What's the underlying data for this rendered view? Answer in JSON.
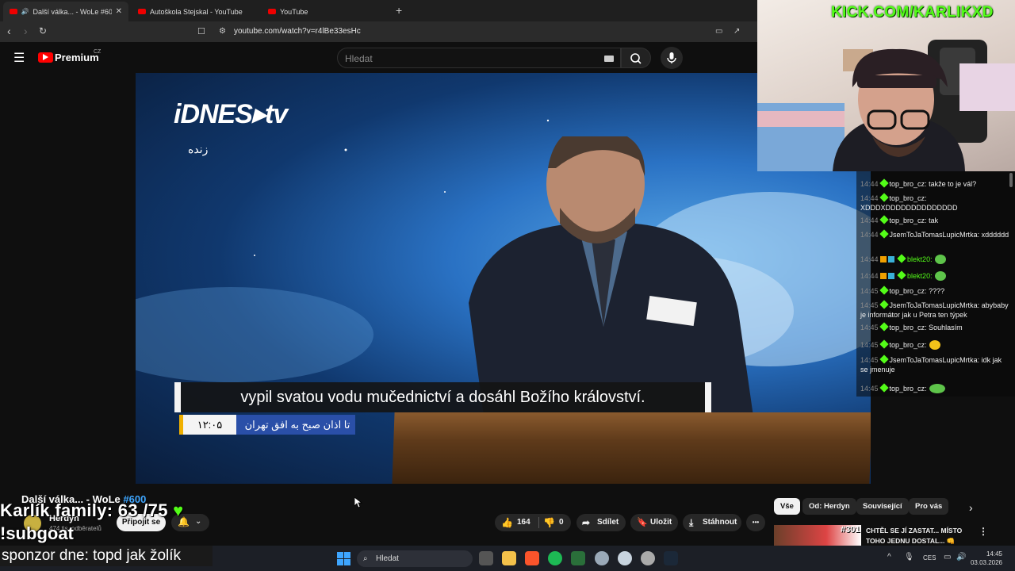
{
  "browser": {
    "tabs": [
      {
        "label": "Další válka... - WoLe #600 - Yo",
        "active": true
      },
      {
        "label": "Autoškola Stejskal - YouTube",
        "active": false
      },
      {
        "label": "YouTube",
        "active": false
      }
    ],
    "new_tab": "+",
    "url": "youtube.com/watch?v=r4lBe33esHc"
  },
  "youtube": {
    "logo_text": "Premium",
    "logo_region": "CZ",
    "search_placeholder": "Hledat"
  },
  "video": {
    "broadcaster_logo": "iDNES▸tv",
    "live_label": "زنده",
    "subtitle": "vypil svatou vodu mučednictví a dosáhl Božího království.",
    "chyron_time": "۱۲:۰۵",
    "chyron_text": "تا اذان صبح به افق تهران"
  },
  "overlay": {
    "kick_url": "KICK.COM/KARLIKXD",
    "family_text": "Karlík family: 63 /75",
    "subgoal_text": "!subgoat",
    "sponsor_text": "sponzor dne: topd jak žolík"
  },
  "chat": {
    "messages": [
      {
        "time": "14:44",
        "user": "top_bro_cz:",
        "text": "takže to je vál?"
      },
      {
        "time": "14:44",
        "user": "top_bro_cz:",
        "text": "XDDDXDDDDDDDDDDDDDD"
      },
      {
        "time": "14:44",
        "user": "top_bro_cz:",
        "text": "tak"
      },
      {
        "time": "14:44",
        "user": "JsemToJaTomasLupicMrtka:",
        "text": "xdddddd"
      },
      {
        "time": "14:44",
        "user": "blekt20:",
        "text": ""
      },
      {
        "time": "14:44",
        "user": "blekt20:",
        "text": ""
      },
      {
        "time": "14:45",
        "user": "top_bro_cz:",
        "text": "????"
      },
      {
        "time": "14:45",
        "user": "JsemToJaTomasLupicMrtka:",
        "text": "abybaby je informátor jak u Petra ten týpek"
      },
      {
        "time": "14:45",
        "user": "top_bro_cz:",
        "text": "Souhlasím"
      },
      {
        "time": "14:45",
        "user": "top_bro_cz:",
        "text": ""
      },
      {
        "time": "14:45",
        "user": "JsemToJaTomasLupicMrtka:",
        "text": "idk jak se jmenuje"
      },
      {
        "time": "14:45",
        "user": "top_bro_cz:",
        "text": ""
      }
    ]
  },
  "watch": {
    "title": "Další válka... - WoLe",
    "title_tag": "#600",
    "channel": "Herdyn",
    "subscribers": "474 tis. odběratelů",
    "join_label": "Připojit se",
    "likes": "164",
    "dislikes": "0",
    "share_label": "Sdílet",
    "save_label": "Uložit",
    "download_label": "Stáhnout",
    "more_label": "•••"
  },
  "related": {
    "chips": [
      "Vše",
      "Od: Herdyn",
      "Související",
      "Pro vás"
    ],
    "first_video_title": "CHTĚL SE JÍ ZASTAT... MÍSTO TOHO JEDNU DOSTAL... 👊",
    "first_video_tag": "#301"
  },
  "taskbar": {
    "search_label": "Hledat",
    "lang": "CES",
    "time": "14:45",
    "date": "03.03.2026"
  }
}
